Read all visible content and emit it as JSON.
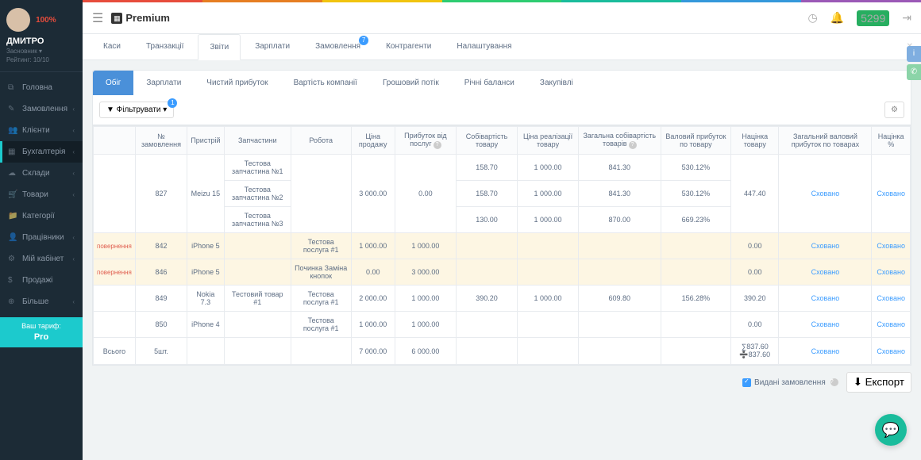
{
  "rainbow": [
    "#e74c3c",
    "#e67e22",
    "#f1c40f",
    "#2ecc71",
    "#1abc9c",
    "#3498db",
    "#9b59b6"
  ],
  "user": {
    "name": "ДМИТРО",
    "role": "Засновник ▾",
    "rating": "Рейтинг: 10/10",
    "percent": "100%"
  },
  "brand": "Premium",
  "topbar_badge": "5299",
  "nav": [
    {
      "icon": "⧉",
      "label": "Головна"
    },
    {
      "icon": "✎",
      "label": "Замовлення",
      "chev": true
    },
    {
      "icon": "👥",
      "label": "Клієнти",
      "chev": true
    },
    {
      "icon": "▦",
      "label": "Бухгалтерія",
      "chev": true,
      "active": true
    },
    {
      "icon": "☁",
      "label": "Склади",
      "chev": true
    },
    {
      "icon": "🛒",
      "label": "Товари",
      "chev": true
    },
    {
      "icon": "📁",
      "label": "Категорії"
    },
    {
      "icon": "👤",
      "label": "Працівники",
      "chev": true
    },
    {
      "icon": "⚙",
      "label": "Мій кабінет",
      "chev": true
    },
    {
      "icon": "$",
      "label": "Продажі"
    },
    {
      "icon": "⊕",
      "label": "Більше",
      "chev": true
    }
  ],
  "tariff": {
    "line1": "Ваш тариф:",
    "line2": "Pro"
  },
  "tabs1": [
    {
      "label": "Каси"
    },
    {
      "label": "Транзакції"
    },
    {
      "label": "Звіти",
      "active": true
    },
    {
      "label": "Зарплати"
    },
    {
      "label": "Замовлення",
      "badge": "7"
    },
    {
      "label": "Контрагенти"
    },
    {
      "label": "Налаштування"
    }
  ],
  "tabs2": [
    {
      "label": "Обіг",
      "active": true
    },
    {
      "label": "Зарплати"
    },
    {
      "label": "Чистий прибуток"
    },
    {
      "label": "Вартість компанії"
    },
    {
      "label": "Грошовий потік"
    },
    {
      "label": "Річні баланси"
    },
    {
      "label": "Закупівлі"
    }
  ],
  "filter_label": "▼ Фільтрувати ▾",
  "filter_badge": "1",
  "headers": [
    "",
    "№ замовлення",
    "Пристрій",
    "Запчастини",
    "Робота",
    "Ціна продажу",
    "Прибуток від послуг",
    "Собівартість товару",
    "Ціна реалізації товару",
    "Загальна собівартість товарів",
    "Валовий прибуток по товару",
    "Націнка товару",
    "Загальний валовий прибуток по товарах",
    "Націнка %"
  ],
  "rows": [
    {
      "group": {
        "tag": "",
        "order": "827",
        "device": "Meizu 15",
        "work": "",
        "price": "3 000.00",
        "profit_svc": "0.00",
        "markup_val": "447.40",
        "gross_hidden": "Сховано",
        "markup_pct": "Сховано"
      },
      "parts": [
        {
          "part": "Тестова запчастина №1",
          "cost": "158.70",
          "real": "1 000.00",
          "total_cost": "841.30",
          "gross": "530.12%"
        },
        {
          "part": "Тестова запчастина №2",
          "cost": "158.70",
          "real": "1 000.00",
          "total_cost": "841.30",
          "gross": "530.12%"
        },
        {
          "part": "Тестова запчастина №3",
          "cost": "130.00",
          "real": "1 000.00",
          "total_cost": "870.00",
          "gross": "669.23%"
        }
      ]
    },
    {
      "warn": true,
      "tag": "повернення",
      "order": "842",
      "device": "iPhone 5",
      "part": "",
      "work": "Тестова послуга #1",
      "price": "1 000.00",
      "profit_svc": "1 000.00",
      "cost": "",
      "real": "",
      "total_cost": "",
      "gross": "",
      "markup_val": "0.00",
      "gross_hidden": "Сховано",
      "markup_pct": "Сховано"
    },
    {
      "warn": true,
      "tag": "повернення",
      "order": "846",
      "device": "iPhone 5",
      "part": "",
      "work": "Починка Заміна кнопок",
      "price": "0.00",
      "profit_svc": "3 000.00",
      "cost": "",
      "real": "",
      "total_cost": "",
      "gross": "",
      "markup_val": "0.00",
      "gross_hidden": "Сховано",
      "markup_pct": "Сховано"
    },
    {
      "tag": "",
      "order": "849",
      "device": "Nokia 7.3",
      "part": "Тестовий товар #1",
      "work": "Тестова послуга #1",
      "price": "2 000.00",
      "profit_svc": "1 000.00",
      "cost": "390.20",
      "real": "1 000.00",
      "total_cost": "609.80",
      "gross": "156.28%",
      "markup_val": "390.20",
      "gross_hidden": "Сховано",
      "markup_pct": "Сховано"
    },
    {
      "tag": "",
      "order": "850",
      "device": "iPhone 4",
      "part": "",
      "work": "Тестова послуга #1",
      "price": "1 000.00",
      "profit_svc": "1 000.00",
      "cost": "",
      "real": "",
      "total_cost": "",
      "gross": "",
      "markup_val": "0.00",
      "gross_hidden": "Сховано",
      "markup_pct": "Сховано"
    }
  ],
  "total_row": {
    "label": "Всього",
    "qty": "5шт.",
    "price": "7 000.00",
    "profit_svc": "6 000.00",
    "markup": "∑837.60\n➗837.60",
    "gross_hidden": "Сховано",
    "markup_pct": "Сховано"
  },
  "footer": {
    "checkbox_label": "Видані замовлення",
    "export_label": "⬇ Експорт"
  }
}
